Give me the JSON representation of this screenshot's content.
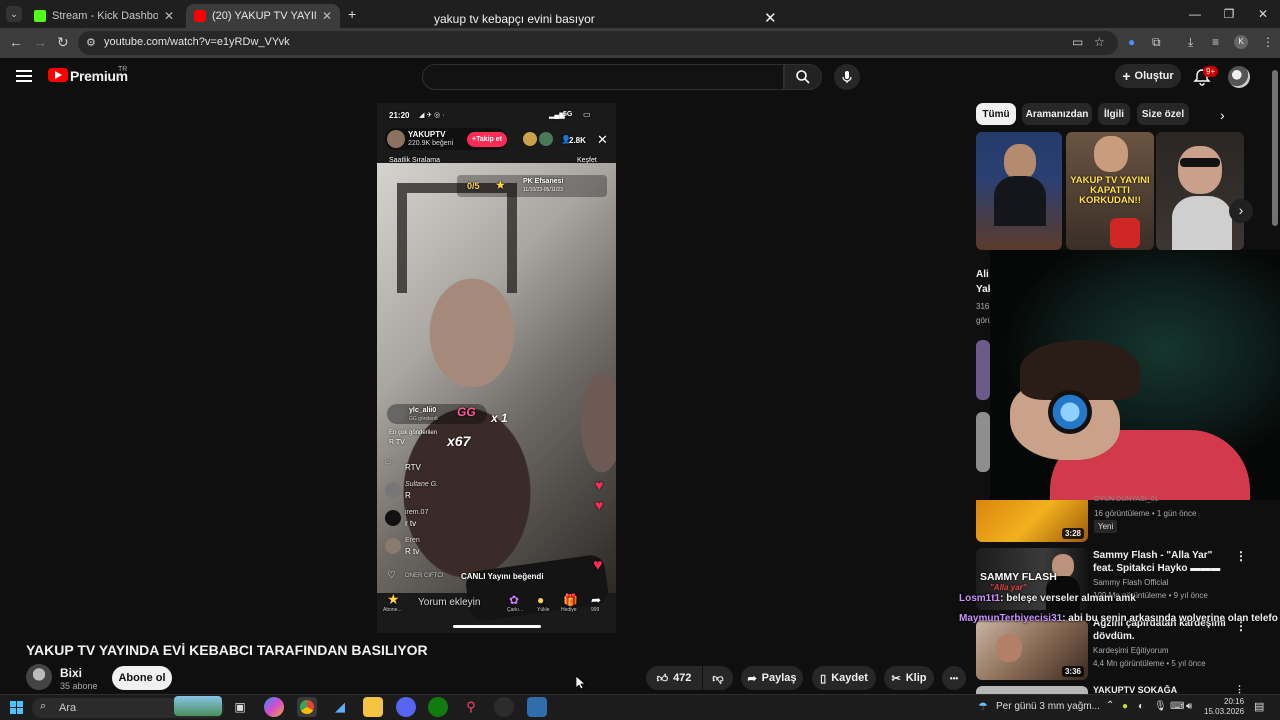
{
  "browser": {
    "tabs": [
      {
        "title": "Stream - Kick Dashboard",
        "favicon_color": "#53fc18"
      },
      {
        "title": "(20) YAKUP TV YAYINDA EVİ KE…",
        "favicon_color": "#ff0000",
        "active": true
      }
    ],
    "new_tab": "+",
    "url": "youtube.com/watch?v=e1yRDw_VYvk"
  },
  "youtube": {
    "logo_text": "Premium",
    "region": "TR",
    "search": {
      "value": "yakup tv kebapçı evini basıyor"
    },
    "create_label": "Oluştur",
    "notif_count": "9+"
  },
  "player_overlay": {
    "status_time": "21:20",
    "status_net": "5G",
    "streamer_name": "YAKUPTV",
    "streamer_likes": "220.9K beğeni",
    "follow_label": "+Takip et",
    "viewers": "2.8K",
    "hourly_rank": "Saatlik Sıralama",
    "explore": "Keşfet",
    "pk_score": "0/5",
    "pk_title": "PK Efsanesi",
    "pk_date": "11/10/23-05/11/23",
    "gift_user": "ylc_alii0",
    "gift_sub": "GG gönderdi",
    "gift_x1": "x 1",
    "gift_x67": "x67",
    "top_sender_label": "En çok gönderilen",
    "top_sender_value": "R TV",
    "chat": [
      {
        "user": "",
        "text": "RTV"
      },
      {
        "user": "Sultane G.",
        "text": "R"
      },
      {
        "user": "irem.07",
        "text": "r tv"
      },
      {
        "user": "Eren",
        "text": "R tv"
      }
    ],
    "liked_notice_user": "ONER CIFTCI",
    "liked_notice_text": "CANLI Yayını beğendi",
    "comment_placeholder": "Yorum ekleyin",
    "bottom_labels": [
      "Abone...",
      "Çarkı...",
      "Yükle",
      "Hediye",
      "999"
    ]
  },
  "video": {
    "title": "YAKUP TV YAYINDA EVİ KEBABCI TARAFINDAN BASILIYOR",
    "channel": "Bixi",
    "subs": "35 abone",
    "subscribe_label": "Abone ol",
    "likes": "472",
    "share_label": "Paylaş",
    "save_label": "Kaydet",
    "clip_label": "Klip",
    "more_label": "•••"
  },
  "sidebar": {
    "chips": [
      "Tümü",
      "Aramanızdan",
      "İlgili",
      "Size özel"
    ],
    "shorts_caption_2": "YAKUP TV YAYINI KAPATTI KORKUDAN!!",
    "top_title_fragment": [
      "Ali",
      "Yak"
    ],
    "top_meta_fragment": [
      "316",
      "görü"
    ],
    "items": [
      {
        "title": "",
        "channel_partial": "OYUN DÜNYASI_01",
        "meta": "16 görüntüleme • 1 gün önce",
        "badge": "Yeni",
        "duration": "3:28"
      },
      {
        "title": "Sammy Flash - \"Alla Yar\" feat. Spitakci Hayko ▬▬▬",
        "channel": "Sammy Flash Official",
        "meta": "109 Mn görüntüleme • 9 yıl önce",
        "duration": "",
        "thumb_text": "SAMMY FLASH",
        "thumb_sub": "\"Alla yar\""
      },
      {
        "title": "Ağzını çapırdatan kardeşimi dövdüm.",
        "channel": "Kardeşimi Eğitiyorum",
        "meta": "4,4 Mn görüntüleme • 5 yıl önce",
        "duration": "3:36"
      },
      {
        "title": "YAKUPTV SOKAĞA",
        "channel": "",
        "meta": "",
        "duration": ""
      }
    ]
  },
  "stream_chat": [
    {
      "user": "Losm1t1",
      "text": ": beleşe verseler almam amk",
      "color": "#c993ff"
    },
    {
      "user": "MaymunTerbiyecisi31",
      "text": ": abi bu senin arkasında wolverine olan telefo",
      "color": "#c993ff"
    }
  ],
  "taskbar": {
    "search_placeholder": "Ara",
    "weather": "Per günü 3 mm yağm...",
    "time": "20:16",
    "date": "15.03.2026"
  },
  "colors": {
    "bg": "#0f0f0f",
    "yt_red": "#ff0000",
    "tiktok_pink": "#fe2c55",
    "chat_purple": "#c993ff"
  }
}
